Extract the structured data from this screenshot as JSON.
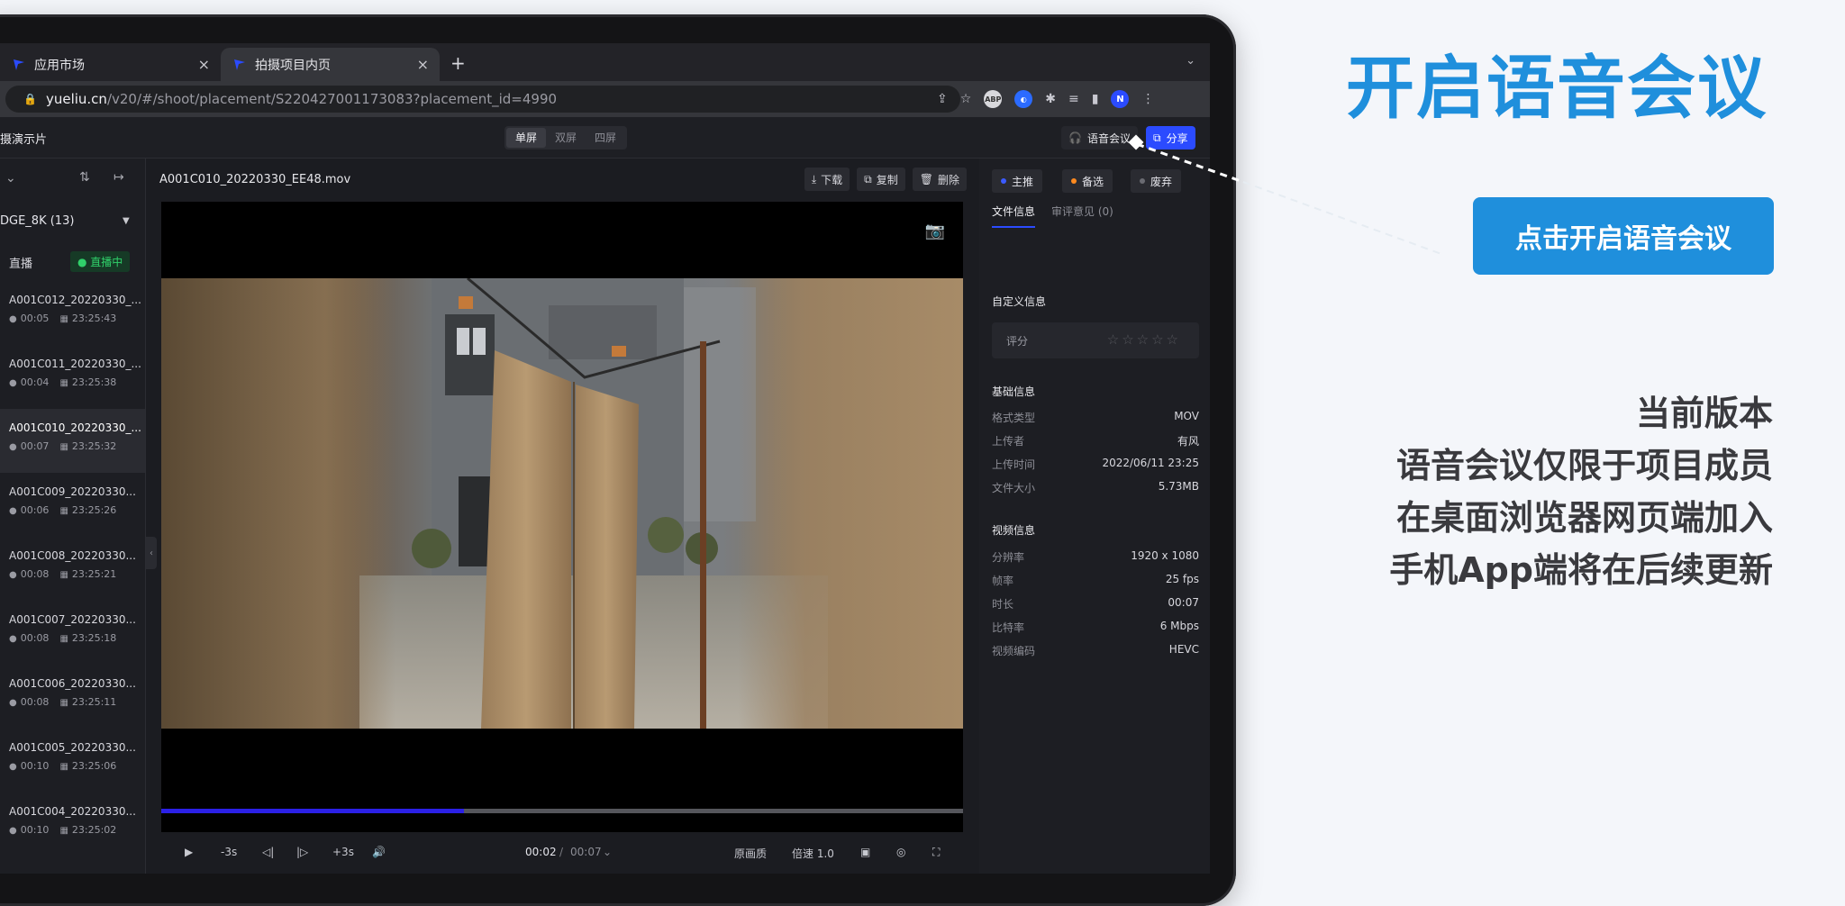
{
  "browser": {
    "tabs": [
      {
        "label": "应用市场"
      },
      {
        "label": "拍摄项目内页"
      }
    ],
    "url_host": "yueliu.cn",
    "url_path": "/v20/#/shoot/placement/S220427001173083?placement_id=4990",
    "ext_abp": "ABP",
    "profile_initial": "N"
  },
  "app": {
    "project_title": "摄演示片",
    "view_modes": [
      "单屏",
      "双屏",
      "四屏"
    ],
    "voice_meeting_label": "语音会议",
    "share_label": "分享"
  },
  "left": {
    "folder_label": "DGE_8K (13)",
    "live_label": "直播",
    "live_badge": "直播中",
    "clips": [
      {
        "name": "A001C012_20220330_...",
        "dur": "00:05",
        "time": "23:25:43"
      },
      {
        "name": "A001C011_20220330_...",
        "dur": "00:04",
        "time": "23:25:38"
      },
      {
        "name": "A001C010_20220330_...",
        "dur": "00:07",
        "time": "23:25:32"
      },
      {
        "name": "A001C009_20220330...",
        "dur": "00:06",
        "time": "23:25:26"
      },
      {
        "name": "A001C008_20220330...",
        "dur": "00:08",
        "time": "23:25:21"
      },
      {
        "name": "A001C007_20220330...",
        "dur": "00:08",
        "time": "23:25:18"
      },
      {
        "name": "A001C006_20220330...",
        "dur": "00:08",
        "time": "23:25:11"
      },
      {
        "name": "A001C005_20220330...",
        "dur": "00:10",
        "time": "23:25:06"
      },
      {
        "name": "A001C004_20220330...",
        "dur": "00:10",
        "time": "23:25:02"
      }
    ]
  },
  "center": {
    "filename": "A001C010_20220330_EE48.mov",
    "download_label": "下载",
    "copy_label": "复制",
    "delete_label": "删除",
    "progress_fraction": 0.377,
    "controls": {
      "back": "-3s",
      "forward": "+3s",
      "current": "00:02",
      "separator": "/",
      "total": "00:07",
      "quality": "原画质",
      "speed": "倍速 1.0"
    }
  },
  "right": {
    "picks": [
      {
        "label": "主推",
        "color": "#3b5bff"
      },
      {
        "label": "备选",
        "color": "#ff8a1f"
      },
      {
        "label": "废弃",
        "color": "#6a6b72"
      }
    ],
    "tab_file_info": "文件信息",
    "tab_review": "审评意见 (0)",
    "custom_title": "自定义信息",
    "rating_label": "评分",
    "rating_stars": "☆☆☆☆☆",
    "basic_title": "基础信息",
    "basic": [
      {
        "k": "格式类型",
        "v": "MOV"
      },
      {
        "k": "上传者",
        "v": "有风"
      },
      {
        "k": "上传时间",
        "v": "2022/06/11 23:25"
      },
      {
        "k": "文件大小",
        "v": "5.73MB"
      }
    ],
    "video_title": "视频信息",
    "video": [
      {
        "k": "分辨率",
        "v": "1920 x 1080"
      },
      {
        "k": "帧率",
        "v": "25 fps"
      },
      {
        "k": "时长",
        "v": "00:07"
      },
      {
        "k": "比特率",
        "v": "6 Mbps"
      },
      {
        "k": "视频编码",
        "v": "HEVC"
      }
    ]
  },
  "annotation": {
    "headline": "开启语音会议",
    "cta": "点击开启语音会议",
    "note_lines": [
      "当前版本",
      "语音会议仅限于项目成员",
      "在桌面浏览器网页端加入",
      "手机App端将在后续更新"
    ]
  },
  "colors": {
    "accent": "#1f8fdc",
    "brand": "#2b4bff"
  }
}
